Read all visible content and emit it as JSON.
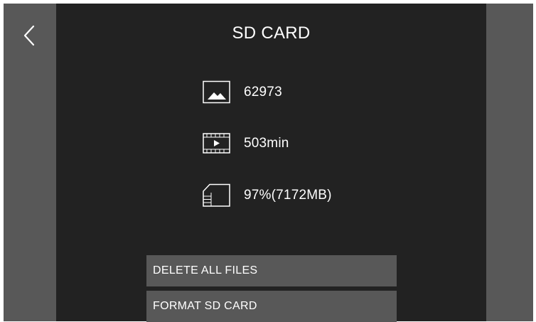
{
  "header": {
    "title": "SD CARD",
    "back_icon": "chevron-left-icon"
  },
  "info": {
    "photos": {
      "icon": "photo-icon",
      "value": "62973"
    },
    "video": {
      "icon": "film-play-icon",
      "value": "503min"
    },
    "storage": {
      "icon": "sd-card-icon",
      "value": "97%(7172MB)"
    }
  },
  "actions": {
    "delete_all_label": "DELETE ALL FILES",
    "format_label": "FORMAT SD CARD"
  },
  "colors": {
    "background": "#222222",
    "side_panel": "#585858",
    "button": "#585858",
    "text": "#ffffff"
  }
}
